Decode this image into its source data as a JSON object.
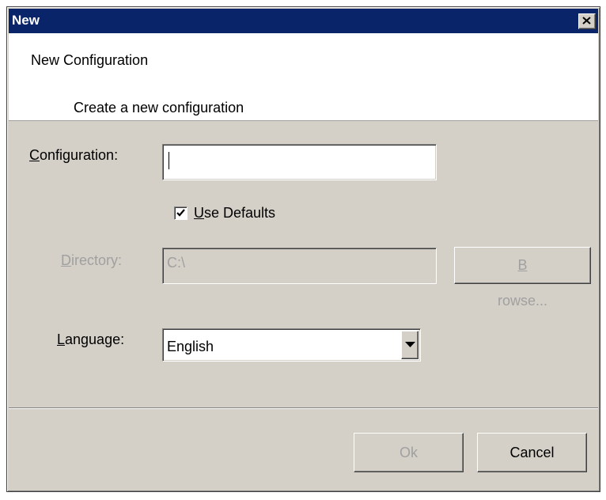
{
  "window": {
    "title": "New"
  },
  "header": {
    "title": "New Configuration",
    "description": "Create a new configuration"
  },
  "form": {
    "configuration": {
      "label": "Configuration:",
      "value": ""
    },
    "use_defaults": {
      "label": "Use Defaults",
      "checked": true
    },
    "directory": {
      "label": "Directory:",
      "value": "C:\\",
      "disabled": true
    },
    "browse_label": "Browse...",
    "language": {
      "label": "Language:",
      "selected": "English"
    }
  },
  "footer": {
    "ok_label": "Ok",
    "cancel_label": "Cancel"
  },
  "colors": {
    "titlebar": "#0a246a",
    "dialog_bg": "#d4d0c8",
    "disabled_text": "#a0a0a0"
  },
  "icons": {
    "close": "close-icon",
    "check": "check-icon",
    "dropdown": "chevron-down-icon"
  }
}
